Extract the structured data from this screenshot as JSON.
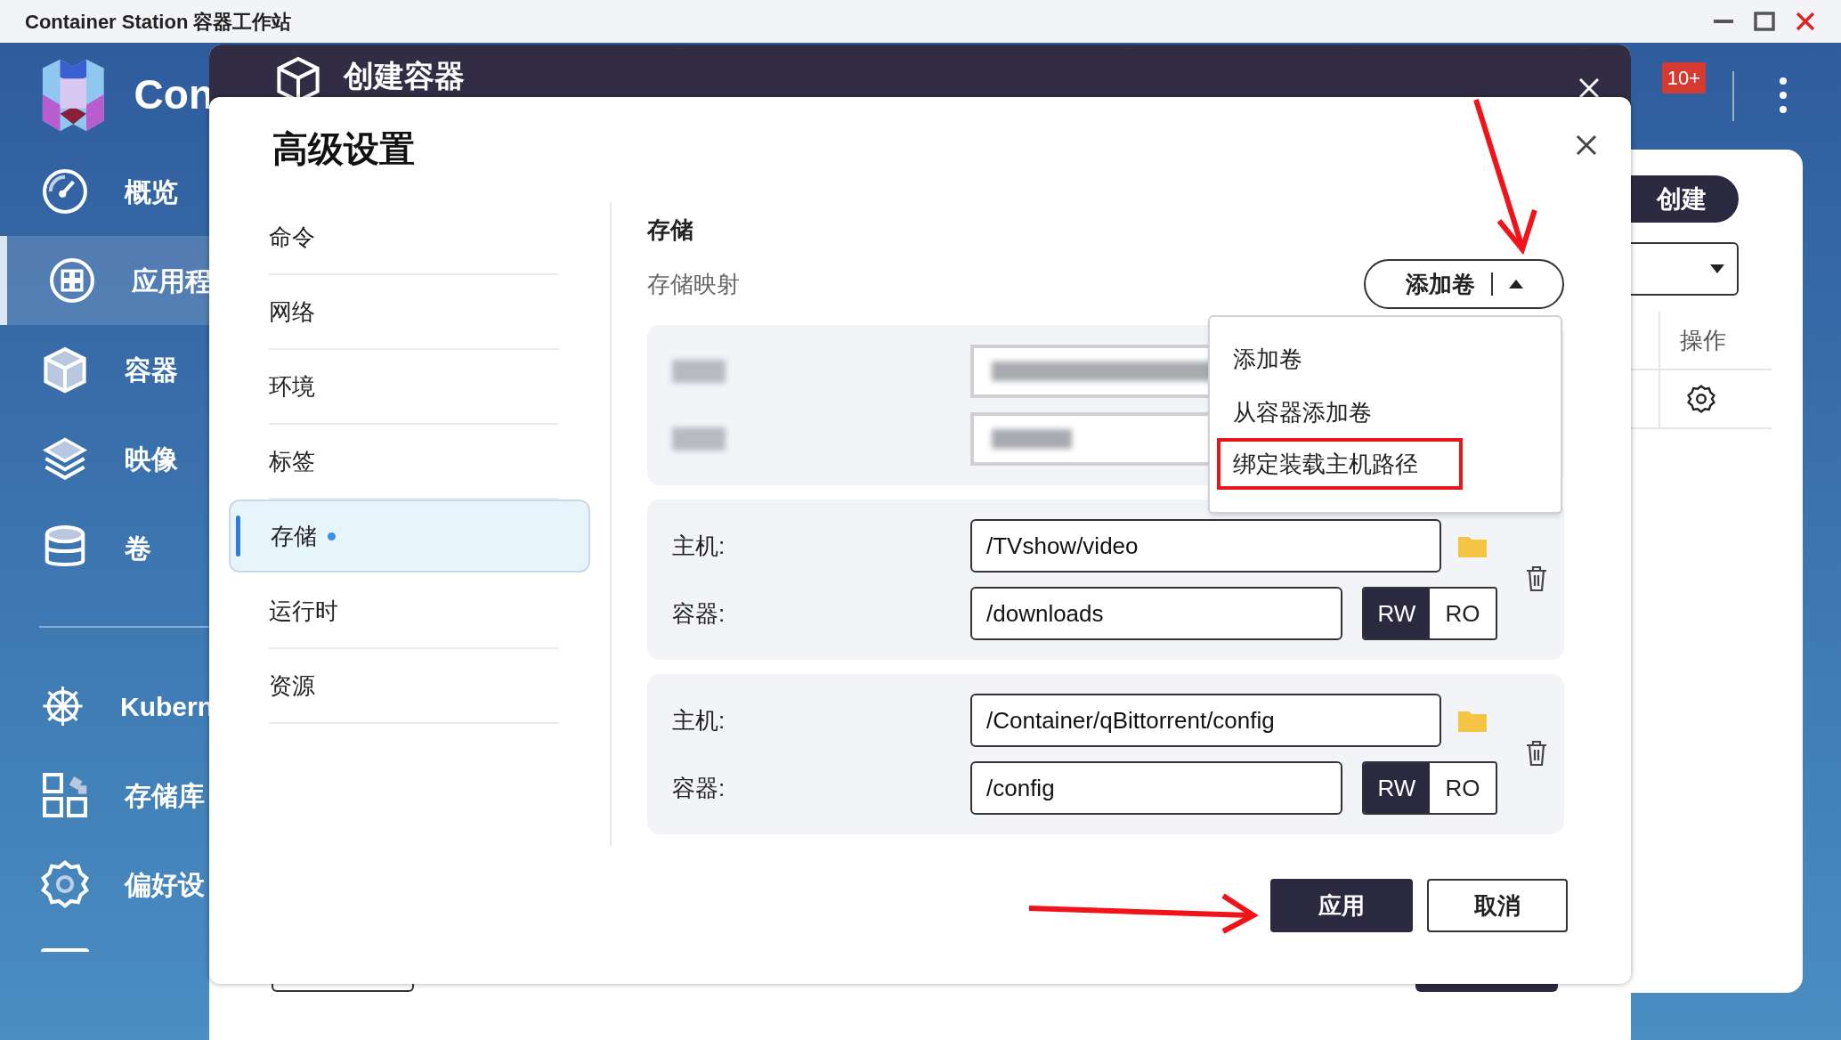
{
  "window": {
    "title": "Container Station 容器工作站"
  },
  "app": {
    "logo_text": "Con",
    "nav": [
      {
        "label": "概览",
        "selected": false
      },
      {
        "label": "应用程",
        "selected": true
      },
      {
        "label": "容器",
        "selected": false
      },
      {
        "label": "映像",
        "selected": false
      },
      {
        "label": "卷",
        "selected": false
      },
      {
        "label": "Kubern",
        "selected": false
      },
      {
        "label": "存储库",
        "selected": false
      },
      {
        "label": "偏好设",
        "selected": false
      }
    ],
    "notification_badge": "10+",
    "create_button": "创建",
    "table_header": "操作"
  },
  "outer_dialog": {
    "title": "创建容器"
  },
  "dialog": {
    "title": "高级设置",
    "tabs": [
      {
        "label": "命令",
        "selected": false,
        "modified": false
      },
      {
        "label": "网络",
        "selected": false,
        "modified": false
      },
      {
        "label": "环境",
        "selected": false,
        "modified": false
      },
      {
        "label": "标签",
        "selected": false,
        "modified": false
      },
      {
        "label": "存储",
        "selected": true,
        "modified": true
      },
      {
        "label": "运行时",
        "selected": false,
        "modified": false
      },
      {
        "label": "资源",
        "selected": false,
        "modified": false
      }
    ],
    "section_title": "存储",
    "subsection": "存储映射",
    "add_button": "添加卷",
    "menu": [
      {
        "label": "添加卷",
        "annotated": false
      },
      {
        "label": "从容器添加卷",
        "annotated": false
      },
      {
        "label": "绑定装载主机路径",
        "annotated": true
      }
    ],
    "mappings": [
      {
        "kind": "blurred"
      },
      {
        "kind": "bind",
        "host_label": "主机:",
        "host": "/TVshow/video",
        "container_label": "容器:",
        "container": "/downloads",
        "modes": [
          {
            "label": "RW",
            "selected": true
          },
          {
            "label": "RO",
            "selected": false
          }
        ]
      },
      {
        "kind": "bind",
        "host_label": "主机:",
        "host": "/Container/qBittorrent/config",
        "container_label": "容器:",
        "container": "/config",
        "modes": [
          {
            "label": "RW",
            "selected": true
          },
          {
            "label": "RO",
            "selected": false
          }
        ]
      }
    ],
    "buttons": [
      {
        "label": "应用",
        "kind": "primary"
      },
      {
        "label": "取消",
        "kind": "secondary"
      }
    ]
  },
  "annotations": [
    {
      "kind": "arrow"
    },
    {
      "kind": "arrow"
    }
  ]
}
